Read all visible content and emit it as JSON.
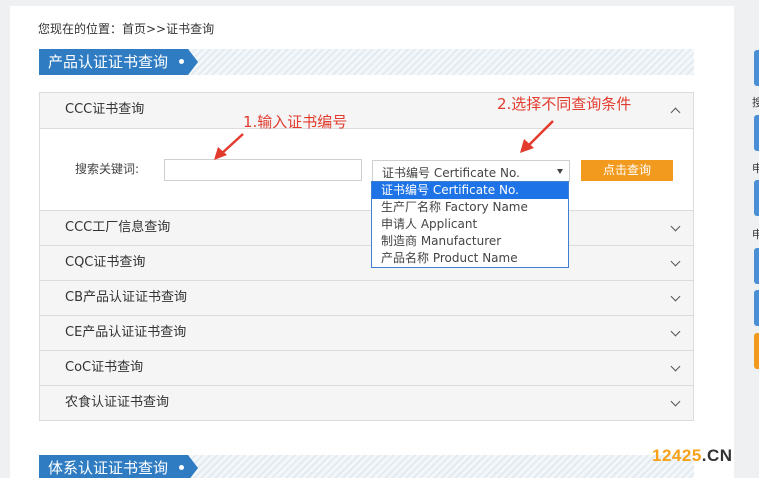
{
  "breadcrumb": {
    "text": "您现在的位置：首页>>证书查询"
  },
  "sections": [
    {
      "title": "产品认证证书查询"
    },
    {
      "title": "体系认证证书查询"
    }
  ],
  "accordion": {
    "expanded_title": "CCC证书查询",
    "items": [
      {
        "title": "CCC工厂信息查询"
      },
      {
        "title": "CQC证书查询"
      },
      {
        "title": "CB产品认证证书查询"
      },
      {
        "title": "CE产品认证证书查询"
      },
      {
        "title": "CoC证书查询"
      },
      {
        "title": "农食认证证书查询"
      }
    ]
  },
  "search": {
    "label": "搜索关键词:",
    "value": "",
    "placeholder": "",
    "select_value": "证书编号 Certificate No.",
    "button_label": "点击查询",
    "options": [
      "证书编号 Certificate No.",
      "生产厂名称 Factory Name",
      "申请人 Applicant",
      "制造商 Manufacturer",
      "产品名称 Product Name"
    ]
  },
  "annotations": {
    "step1": "1.输入证书编号",
    "step2": "2.选择不同查询条件",
    "color": "#e23b2e"
  },
  "sidebar_fragments": [
    "搜",
    "申",
    "申"
  ],
  "watermark": {
    "number": "12425",
    "domain": ".CN"
  },
  "colors": {
    "accent": "#2f7cc3",
    "button": "#f29a1d",
    "selected_option": "#1e73e6"
  }
}
